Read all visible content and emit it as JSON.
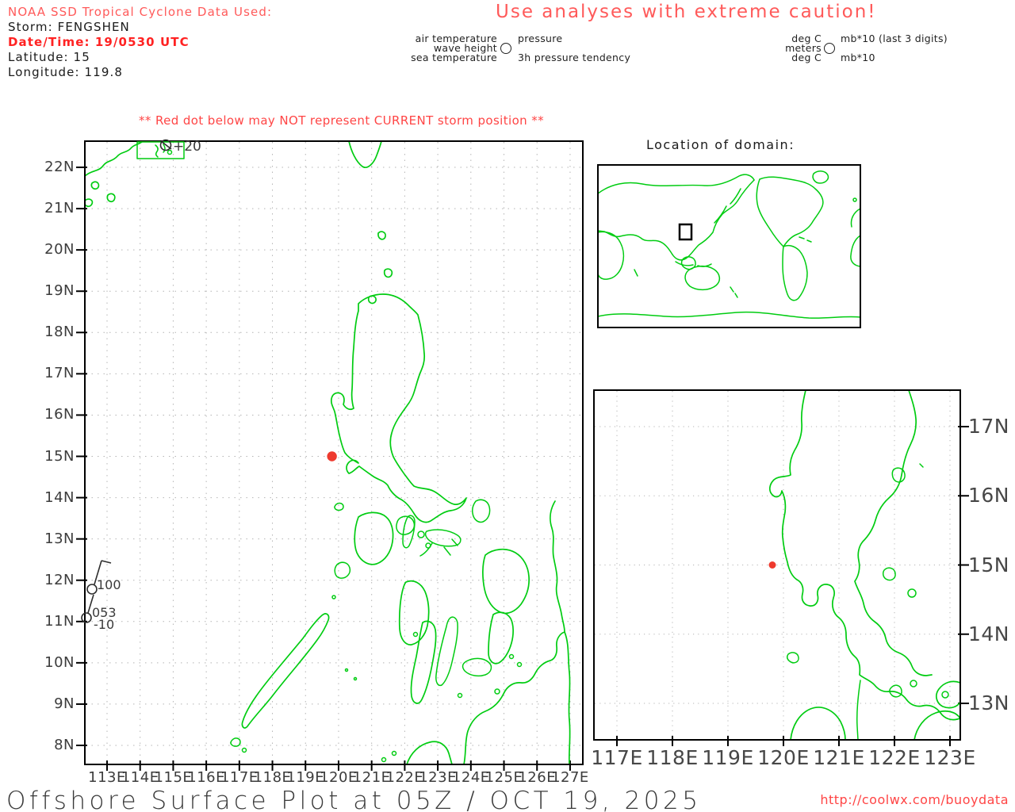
{
  "colors": {
    "map_green": "#00cc11",
    "light_red": "#ff5a5a",
    "strong_red": "#ff2222",
    "warning_red": "#ff4545",
    "dot_red": "#ee3a2e",
    "axis_gray": "#3c3c3c"
  },
  "header": {
    "source_note": "NOAA SSD Tropical Cyclone Data Used:",
    "storm": "Storm: FENGSHEN",
    "datetime": "Date/Time: 19/0530 UTC",
    "latitude": "Latitude: 15",
    "longitude": "Longitude: 119.8",
    "caution": "Use analyses with extreme caution!"
  },
  "station_legend": {
    "left_labels": [
      "air temperature",
      "wave height",
      "sea temperature"
    ],
    "right_labels": [
      "pressure",
      "3h pressure tendency"
    ],
    "units_left": [
      "deg C",
      "meters",
      "deg C"
    ],
    "units_right": [
      "mb*10 (last 3 digits)",
      "mb*10"
    ]
  },
  "warning": "** Red dot below may NOT represent CURRENT storm position **",
  "main_map": {
    "x_ticks": [
      "113E",
      "114E",
      "115E",
      "116E",
      "117E",
      "118E",
      "119E",
      "120E",
      "121E",
      "122E",
      "123E",
      "124E",
      "125E",
      "126E",
      "127E"
    ],
    "y_ticks": [
      "8N",
      "9N",
      "10N",
      "11N",
      "12N",
      "13N",
      "14N",
      "15N",
      "16N",
      "17N",
      "18N",
      "19N",
      "20N",
      "21N",
      "22N"
    ],
    "storm_dot": {
      "lon": 119.8,
      "lat": 15
    },
    "stations": [
      {
        "value": "+20"
      },
      {
        "value": "100"
      },
      {
        "value": "053",
        "tendency": "-10"
      }
    ]
  },
  "domain_inset": {
    "title": "Location of domain:"
  },
  "zoom_inset": {
    "x_ticks": [
      "117E",
      "118E",
      "119E",
      "120E",
      "121E",
      "122E",
      "123E"
    ],
    "y_ticks": [
      "13N",
      "14N",
      "15N",
      "16N",
      "17N"
    ],
    "storm_dot": {
      "lon": 119.8,
      "lat": 15
    }
  },
  "footer": {
    "title": "Offshore Surface Plot at 05Z / OCT 19, 2025",
    "url": "http://coolwx.com/buoydata"
  }
}
